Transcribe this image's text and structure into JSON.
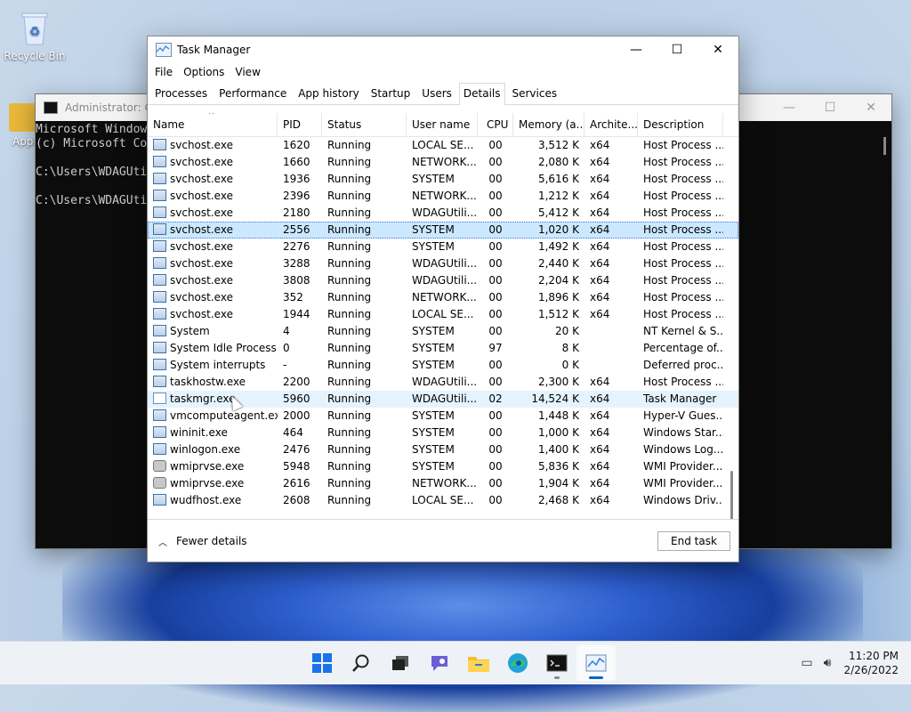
{
  "desktop": {
    "icons": [
      {
        "label": "Recycle Bin"
      },
      {
        "label": "Appli"
      }
    ]
  },
  "console": {
    "title": "Administrator: Co",
    "lines": [
      "Microsoft Window",
      "(c) Microsoft Co",
      "",
      "C:\\Users\\WDAGUti",
      "",
      "C:\\Users\\WDAGUti"
    ]
  },
  "taskmanager": {
    "title": "Task Manager",
    "menu": [
      "File",
      "Options",
      "View"
    ],
    "tabs": [
      "Processes",
      "Performance",
      "App history",
      "Startup",
      "Users",
      "Details",
      "Services"
    ],
    "active_tab": "Details",
    "columns": [
      "Name",
      "PID",
      "Status",
      "User name",
      "CPU",
      "Memory (a...",
      "Archite...",
      "Description"
    ],
    "rows": [
      {
        "name": "svchost.exe",
        "pid": "1620",
        "status": "Running",
        "user": "LOCAL SE...",
        "cpu": "00",
        "mem": "3,512 K",
        "arch": "x64",
        "desc": "Host Process ...",
        "icon": "service"
      },
      {
        "name": "svchost.exe",
        "pid": "1660",
        "status": "Running",
        "user": "NETWORK...",
        "cpu": "00",
        "mem": "2,080 K",
        "arch": "x64",
        "desc": "Host Process ...",
        "icon": "service"
      },
      {
        "name": "svchost.exe",
        "pid": "1936",
        "status": "Running",
        "user": "SYSTEM",
        "cpu": "00",
        "mem": "5,616 K",
        "arch": "x64",
        "desc": "Host Process ...",
        "icon": "service"
      },
      {
        "name": "svchost.exe",
        "pid": "2396",
        "status": "Running",
        "user": "NETWORK...",
        "cpu": "00",
        "mem": "1,212 K",
        "arch": "x64",
        "desc": "Host Process ...",
        "icon": "service"
      },
      {
        "name": "svchost.exe",
        "pid": "2180",
        "status": "Running",
        "user": "WDAGUtili...",
        "cpu": "00",
        "mem": "5,412 K",
        "arch": "x64",
        "desc": "Host Process ...",
        "icon": "service"
      },
      {
        "name": "svchost.exe",
        "pid": "2556",
        "status": "Running",
        "user": "SYSTEM",
        "cpu": "00",
        "mem": "1,020 K",
        "arch": "x64",
        "desc": "Host Process ...",
        "icon": "service",
        "selected": true
      },
      {
        "name": "svchost.exe",
        "pid": "2276",
        "status": "Running",
        "user": "SYSTEM",
        "cpu": "00",
        "mem": "1,492 K",
        "arch": "x64",
        "desc": "Host Process ...",
        "icon": "service"
      },
      {
        "name": "svchost.exe",
        "pid": "3288",
        "status": "Running",
        "user": "WDAGUtili...",
        "cpu": "00",
        "mem": "2,440 K",
        "arch": "x64",
        "desc": "Host Process ...",
        "icon": "service"
      },
      {
        "name": "svchost.exe",
        "pid": "3808",
        "status": "Running",
        "user": "WDAGUtili...",
        "cpu": "00",
        "mem": "2,204 K",
        "arch": "x64",
        "desc": "Host Process ...",
        "icon": "service"
      },
      {
        "name": "svchost.exe",
        "pid": "352",
        "status": "Running",
        "user": "NETWORK...",
        "cpu": "00",
        "mem": "1,896 K",
        "arch": "x64",
        "desc": "Host Process ...",
        "icon": "service"
      },
      {
        "name": "svchost.exe",
        "pid": "1944",
        "status": "Running",
        "user": "LOCAL SE...",
        "cpu": "00",
        "mem": "1,512 K",
        "arch": "x64",
        "desc": "Host Process ...",
        "icon": "service"
      },
      {
        "name": "System",
        "pid": "4",
        "status": "Running",
        "user": "SYSTEM",
        "cpu": "00",
        "mem": "20 K",
        "arch": "",
        "desc": "NT Kernel & S...",
        "icon": "service"
      },
      {
        "name": "System Idle Process",
        "pid": "0",
        "status": "Running",
        "user": "SYSTEM",
        "cpu": "97",
        "mem": "8 K",
        "arch": "",
        "desc": "Percentage of...",
        "icon": "service"
      },
      {
        "name": "System interrupts",
        "pid": "-",
        "status": "Running",
        "user": "SYSTEM",
        "cpu": "00",
        "mem": "0 K",
        "arch": "",
        "desc": "Deferred proc...",
        "icon": "service"
      },
      {
        "name": "taskhostw.exe",
        "pid": "2200",
        "status": "Running",
        "user": "WDAGUtili...",
        "cpu": "00",
        "mem": "2,300 K",
        "arch": "x64",
        "desc": "Host Process ...",
        "icon": "service"
      },
      {
        "name": "taskmgr.exe",
        "pid": "5960",
        "status": "Running",
        "user": "WDAGUtili...",
        "cpu": "02",
        "mem": "14,524 K",
        "arch": "x64",
        "desc": "Task Manager",
        "icon": "monitor",
        "hover": true
      },
      {
        "name": "vmcomputeagent.exe",
        "pid": "2000",
        "status": "Running",
        "user": "SYSTEM",
        "cpu": "00",
        "mem": "1,448 K",
        "arch": "x64",
        "desc": "Hyper-V Gues...",
        "icon": "service"
      },
      {
        "name": "wininit.exe",
        "pid": "464",
        "status": "Running",
        "user": "SYSTEM",
        "cpu": "00",
        "mem": "1,000 K",
        "arch": "x64",
        "desc": "Windows Star...",
        "icon": "service"
      },
      {
        "name": "winlogon.exe",
        "pid": "2476",
        "status": "Running",
        "user": "SYSTEM",
        "cpu": "00",
        "mem": "1,400 K",
        "arch": "x64",
        "desc": "Windows Log...",
        "icon": "service"
      },
      {
        "name": "wmiprvse.exe",
        "pid": "5948",
        "status": "Running",
        "user": "SYSTEM",
        "cpu": "00",
        "mem": "5,836 K",
        "arch": "x64",
        "desc": "WMI Provider...",
        "icon": "gear"
      },
      {
        "name": "wmiprvse.exe",
        "pid": "2616",
        "status": "Running",
        "user": "NETWORK...",
        "cpu": "00",
        "mem": "1,904 K",
        "arch": "x64",
        "desc": "WMI Provider...",
        "icon": "gear"
      },
      {
        "name": "wudfhost.exe",
        "pid": "2608",
        "status": "Running",
        "user": "LOCAL SE...",
        "cpu": "00",
        "mem": "2,468 K",
        "arch": "x64",
        "desc": "Windows Driv...",
        "icon": "service"
      }
    ],
    "footer": {
      "fewer_details": "Fewer details",
      "end_task": "End task"
    }
  },
  "taskbar": {
    "apps": [
      "start-icon",
      "search-icon",
      "task-view-icon",
      "chat-icon",
      "file-explorer-icon",
      "edge-icon",
      "terminal-icon",
      "task-manager-icon"
    ],
    "time": "11:20 PM",
    "date": "2/26/2022"
  },
  "colors": {
    "selection": "#cce8ff",
    "accent": "#0067c0"
  }
}
